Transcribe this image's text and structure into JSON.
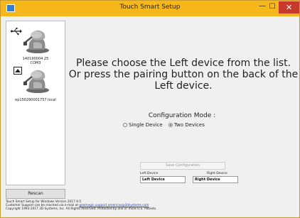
{
  "window": {
    "title": "Touch Smart Setup",
    "minimize_glyph": "—",
    "maximize_glyph": "☐",
    "close_glyph": "✕"
  },
  "device_list": [
    {
      "icon": "usb-icon",
      "serial": "140190004 25",
      "port": "COM3"
    },
    {
      "icon": "network-icon",
      "serial": "ep150290001757.local"
    }
  ],
  "rescan_label": "Rescan",
  "message_lines": [
    "Please choose the Left device from the list.",
    "Or press the pairing button on the back of the",
    "Left device."
  ],
  "config": {
    "label": "Configuration Mode :",
    "options": [
      {
        "label": "Single Device",
        "selected": false
      },
      {
        "label": "Two Devices",
        "selected": true
      }
    ]
  },
  "save_config_label": "Save Configuration",
  "left_device_label": "Left Device",
  "right_device_label": "Right Device",
  "left_device_value": "Left Device",
  "right_device_value": "Right Device",
  "footer": {
    "line1": "Touch Smart Setup for Windows Version 2017.9.5",
    "line2_prefix": "Customer Support can be reached via e-mail at ",
    "line2_link": "geomagic.support.americas@3dsystems.com",
    "line3": "Copyright 1993-2017 3D Systems, Inc. All Rights Reserved. Protected by one or more U.S. Patents."
  },
  "colors": {
    "titlebar": "#f5b719",
    "close_button": "#c7392b",
    "link": "#1a3cc8"
  }
}
